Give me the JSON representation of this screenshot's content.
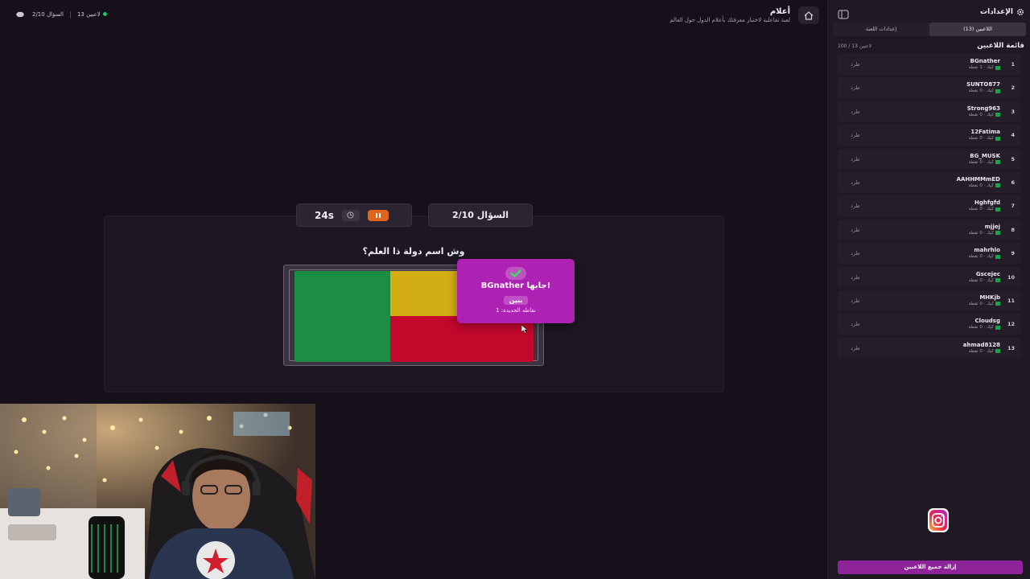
{
  "topbar": {
    "player_count": "13 لاعبين",
    "question_progress": "السؤال 2/10",
    "app_title": "أعلام",
    "app_subtitle": "لعبة تفاعلية لاختبار معرفتك بأعلام الدول حول العالم"
  },
  "game": {
    "timer": "24s",
    "question_counter": "السؤال 2/10",
    "question": "وش اسم دولة ذا العلم؟",
    "flag_colors": {
      "green": "#1b8e44",
      "yellow": "#d2ad14",
      "red": "#c3082c"
    },
    "popup": {
      "answer_line": "BGnather جابها!",
      "country": "بنين",
      "points_line": "نقاطه الجديدة: 1"
    }
  },
  "sidebar": {
    "title": "الإعدادات",
    "tabs": [
      "اللاعبين (13)",
      "إعدادات اللعبة"
    ],
    "players_title": "قائمة اللاعبين",
    "players_count": "100 / 13 لاعبين",
    "kick_label": "طرد",
    "players": [
      {
        "rank": "1",
        "name": "BGnather",
        "sub": "كيك · 1 نقطة"
      },
      {
        "rank": "2",
        "name": "SUNTO877",
        "sub": "كيك · 0 نقطة"
      },
      {
        "rank": "3",
        "name": "Strong963",
        "sub": "كيك · 0 نقطة"
      },
      {
        "rank": "4",
        "name": "12Fatima",
        "sub": "كيك · 0 نقطة"
      },
      {
        "rank": "5",
        "name": "BG_MUSK",
        "sub": "كيك · 0 نقطة"
      },
      {
        "rank": "6",
        "name": "AAHHMMmED",
        "sub": "كيك · 0 نقطة"
      },
      {
        "rank": "7",
        "name": "Hghfgfd",
        "sub": "كيك · 0 نقطة"
      },
      {
        "rank": "8",
        "name": "mjjej",
        "sub": "كيك · 0 نقطة"
      },
      {
        "rank": "9",
        "name": "mahrhlo",
        "sub": "كيك · 0 نقطة"
      },
      {
        "rank": "10",
        "name": "Gscejec",
        "sub": "كيك · 0 نقطة"
      },
      {
        "rank": "11",
        "name": "MHKjb",
        "sub": "كيك · 0 نقطة"
      },
      {
        "rank": "12",
        "name": "Cloudsg",
        "sub": "كيك · 0 نقطة"
      },
      {
        "rank": "13",
        "name": "ahmad8128",
        "sub": "كيك · 0 نقطة"
      }
    ],
    "remove_all": "إزالة جميع اللاعبين"
  },
  "colors": {
    "accent_purple": "#ad22b2",
    "pause_orange": "#e0651f",
    "online_green": "#22c55e"
  }
}
